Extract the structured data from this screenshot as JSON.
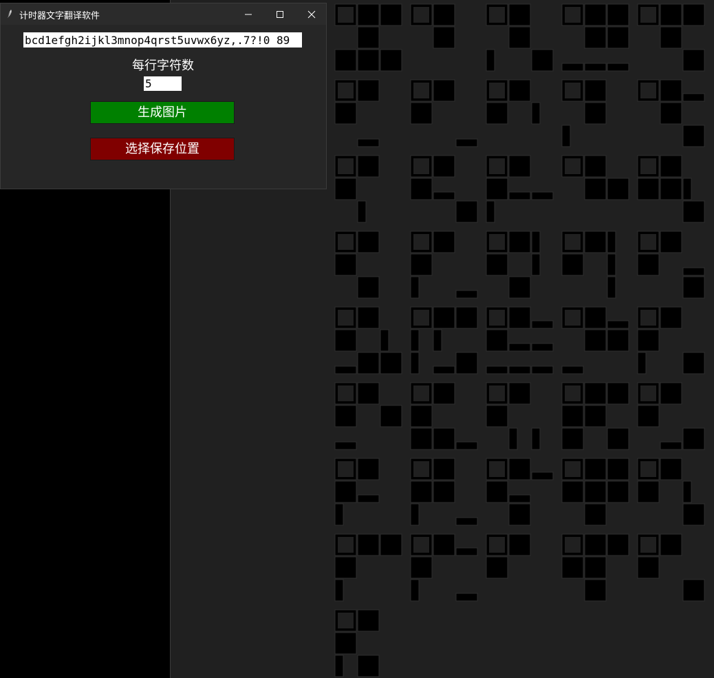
{
  "window": {
    "title": "计时器文字翻译软件"
  },
  "form": {
    "text_value": "bcd1efgh2ijkl3mnop4qrst5uvwx6yz,.7?!0 89",
    "chars_per_line_label": "每行字符数",
    "chars_per_line_value": "5",
    "generate_label": "生成图片",
    "save_location_label": "选择保存位置"
  },
  "colors": {
    "generate_bg": "#008000",
    "save_bg": "#800000",
    "canvas_bg": "#202020",
    "cell_fill": "#000000"
  },
  "icons": {
    "app": "feather-icon",
    "minimize": "minimize-icon",
    "maximize": "maximize-icon",
    "close": "close-icon"
  }
}
